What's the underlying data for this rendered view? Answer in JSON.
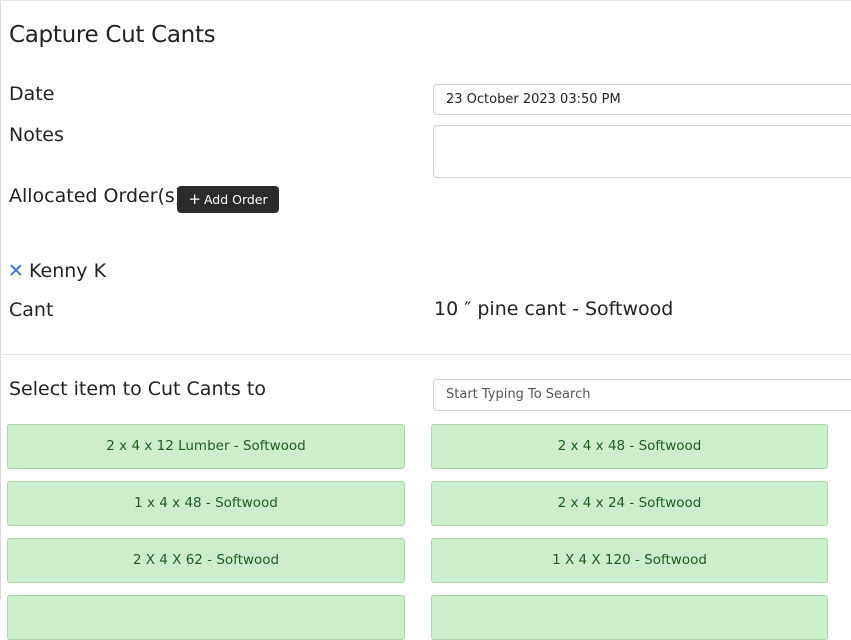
{
  "page": {
    "title": "Capture Cut Cants"
  },
  "form": {
    "date_label": "Date",
    "date_value": "23 October 2023 03:50 PM",
    "notes_label": "Notes",
    "notes_value": "",
    "orders_label": "Allocated Order(s)",
    "add_order_label": "Add Order",
    "add_order_icon": "plus-icon",
    "allocated_order": {
      "remove_icon": "close-icon",
      "name": "Kenny K"
    },
    "cant_label": "Cant",
    "cant_value": "10 ″ pine cant - Softwood"
  },
  "items_section": {
    "label": "Select item to Cut Cants to",
    "search_placeholder": "Start Typing To Search",
    "items": [
      "2 x 4 x 12 Lumber - Softwood",
      "2 x 4 x 48 - Softwood",
      "1 x 4 x 48 - Softwood",
      "2 x 4 x 24 - Softwood",
      "2 X 4 X 62 - Softwood",
      "1 X 4 X 120 - Softwood",
      "",
      ""
    ],
    "item_bg_color": "#cdeecd",
    "item_text_color": "#1e5e1e"
  }
}
